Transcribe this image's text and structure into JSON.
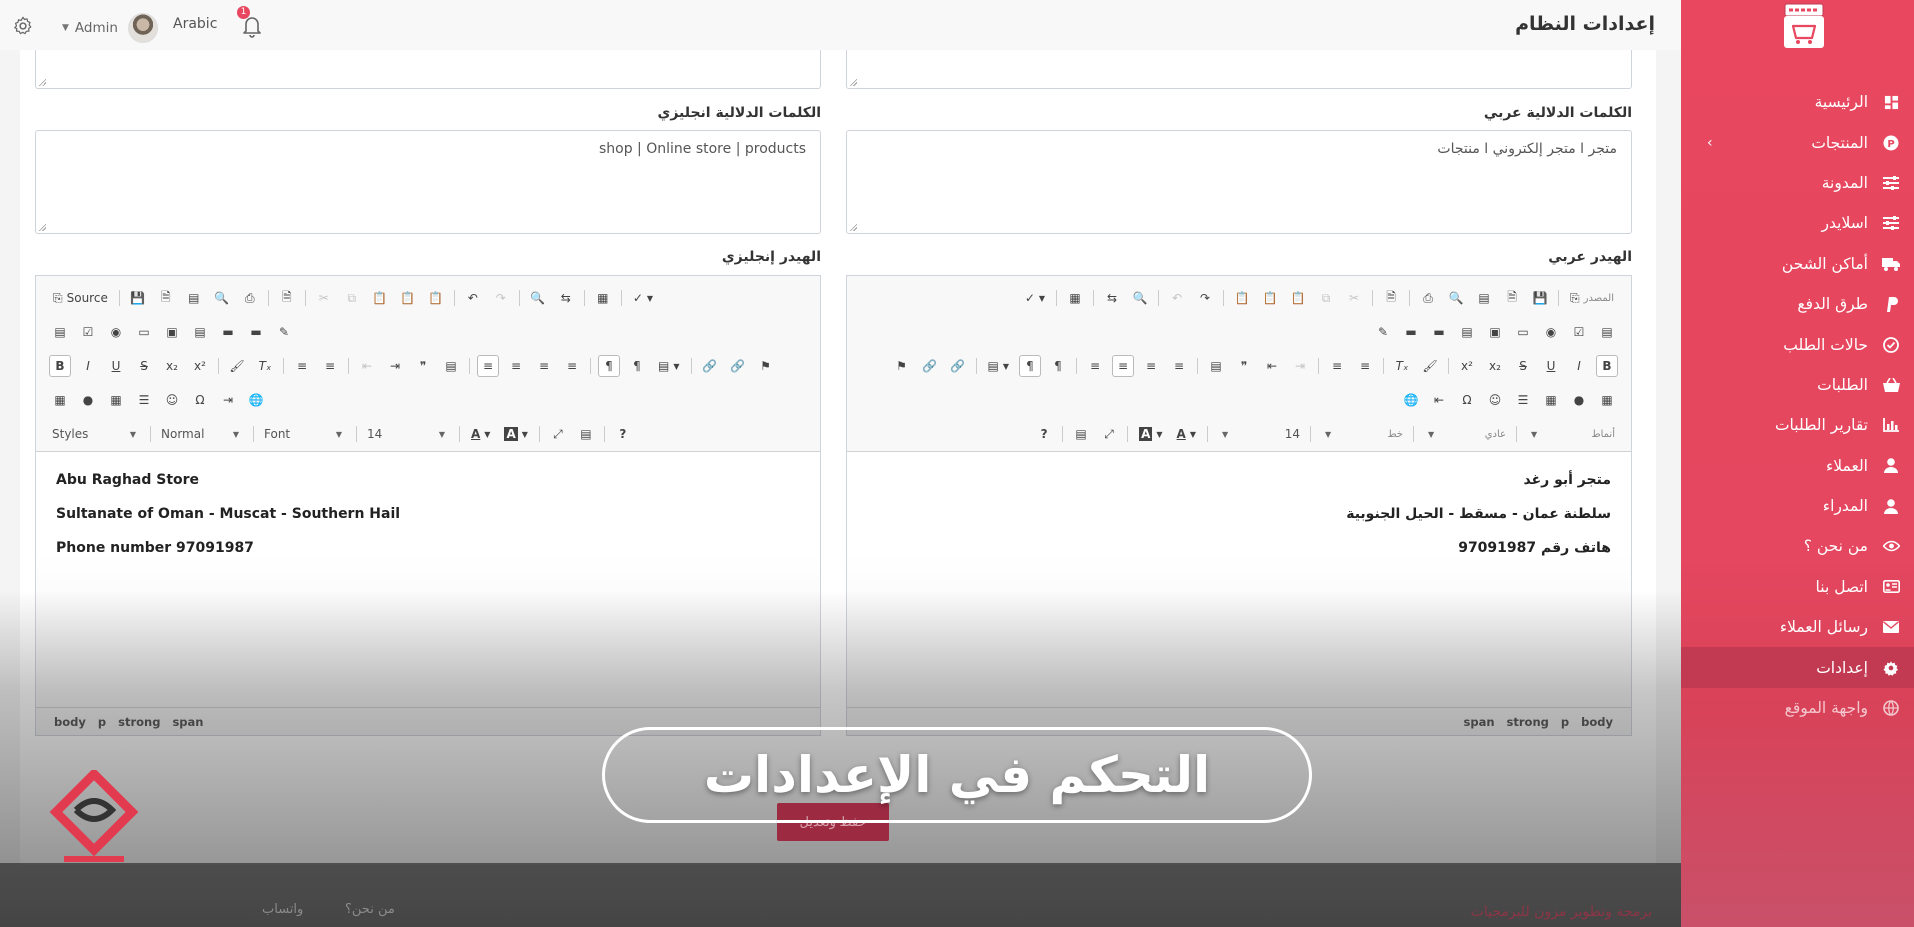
{
  "topbar": {
    "title": "إعدادات النظام",
    "user_name": "Admin",
    "language": "Arabic",
    "notification_count": "1"
  },
  "sidebar": {
    "items": [
      {
        "label": "الرئيسية",
        "icon": "dashboard-icon"
      },
      {
        "label": "المنتجات",
        "icon": "product-p-icon"
      },
      {
        "label": "المدونة",
        "icon": "sliders-icon"
      },
      {
        "label": "اسلايدر",
        "icon": "sliders-icon"
      },
      {
        "label": "أماكن الشحن",
        "icon": "truck-icon"
      },
      {
        "label": "طرق الدفع",
        "icon": "paypal-icon"
      },
      {
        "label": "حالات الطلب",
        "icon": "check-circle-icon"
      },
      {
        "label": "الطلبات",
        "icon": "basket-icon"
      },
      {
        "label": "تقارير الطلبات",
        "icon": "chart-icon"
      },
      {
        "label": "العملاء",
        "icon": "user-icon"
      },
      {
        "label": "المدراء",
        "icon": "user-icon"
      },
      {
        "label": "من نحن ؟",
        "icon": "eye-icon"
      },
      {
        "label": "اتصل بنا",
        "icon": "id-card-icon"
      },
      {
        "label": "رسائل العملاء",
        "icon": "envelope-icon"
      },
      {
        "label": "إعدادات",
        "icon": "gear-icon"
      },
      {
        "label": "واجهة الموقع",
        "icon": "globe-icon"
      }
    ]
  },
  "form": {
    "keywords_ar_label": "الكلمات الدلالية عربي",
    "keywords_en_label": "الكلمات الدلالية انجليزي",
    "keywords_ar_value": "متجر ا متجر إلكتروني ا منتجات",
    "keywords_en_value": "shop | Online store | products",
    "header_ar_label": "الهيدر عربي",
    "header_en_label": "الهيدر إنجليزي",
    "save_label": "حفظ وتعديل"
  },
  "editor_en": {
    "source_label": "Source",
    "styles": "Styles",
    "format": "Normal",
    "font": "Font",
    "size": "14",
    "lines": [
      "Abu Raghad Store",
      "Sultanate of Oman - Muscat - Southern Hail",
      "Phone number 97091987"
    ],
    "path": [
      "body",
      "p",
      "strong",
      "span"
    ]
  },
  "editor_ar": {
    "source_label": "المصدر",
    "styles": "أنماط",
    "format": "عادي",
    "font": "خط",
    "size": "14",
    "lines": [
      "متجر أبو رغد",
      "سلطنة عمان - مسقط - الحيل الجنوبية",
      "هاتف رقم 97091987"
    ],
    "path": [
      "body",
      "p",
      "strong",
      "span"
    ]
  },
  "overlay": {
    "banner_text": "التحكم في الإعدادات"
  },
  "footer": {
    "links": [
      "من نحن؟",
      "واتساب"
    ],
    "credit": "برمجة وتطوير مزون للبرمجيات"
  },
  "colors": {
    "sidebar": "#e8475f",
    "active": "#c23a52",
    "save_button": "#9c2b42"
  }
}
